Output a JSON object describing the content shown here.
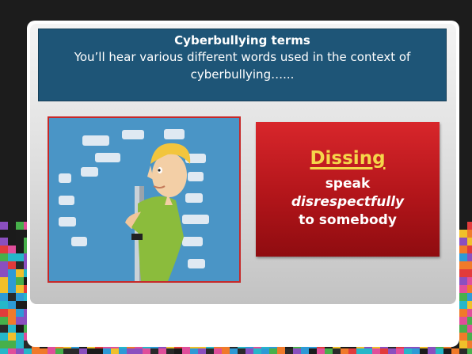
{
  "slide": {
    "title": "Cyberbullying terms",
    "subtitle": "You’ll hear various different words used in the context of cyberbullying…..."
  },
  "definition": {
    "term": "Dissing",
    "line1": "speak",
    "line2": "disrespectfully",
    "line3": "to somebody"
  },
  "colors": {
    "title_bg": "#1e5577",
    "definition_bg": "#b2151a",
    "term_color": "#f5d64a",
    "illustration_bg": "#4a95c6"
  }
}
